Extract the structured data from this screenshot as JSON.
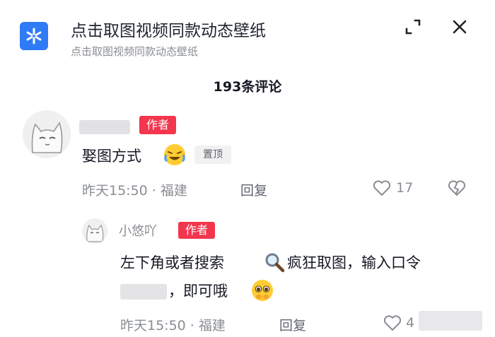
{
  "header": {
    "title": "点击取图视频同款动态壁纸",
    "subtitle": "点击取图视频同款动态壁纸",
    "app_color": "#2f7bf6"
  },
  "comments_count": "193条评论",
  "comments": [
    {
      "author_badge": "作者",
      "text": "娶图方式",
      "pin_label": "置顶",
      "time": "昨天15:50 · 福建",
      "reply_label": "回复",
      "likes": "17",
      "replies": [
        {
          "name": "小悠吖",
          "author_badge": "作者",
          "line1": "左下角或者搜索",
          "line1_after": "疯狂取图，输入口令",
          "line2": "，即可哦",
          "time": "昨天15:50 · 福建",
          "reply_label": "回复",
          "likes": "4"
        }
      ]
    }
  ],
  "colors": {
    "badge_red": "#f2364d",
    "text_dark": "#161823",
    "text_gray": "#8a8d93"
  }
}
